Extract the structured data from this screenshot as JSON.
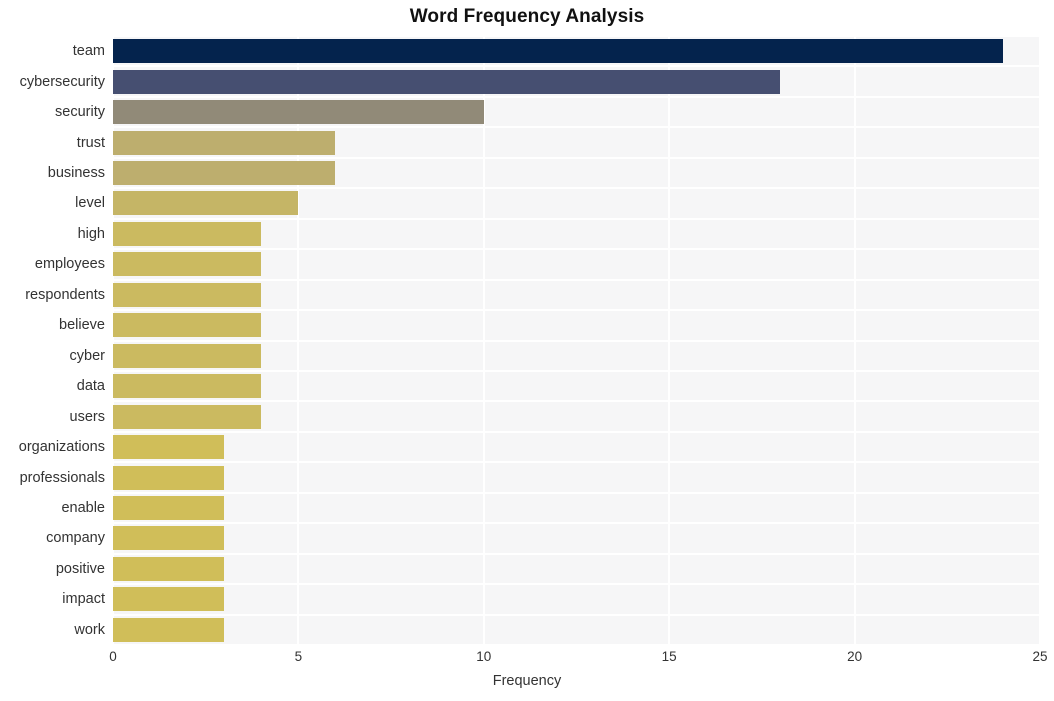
{
  "chart_data": {
    "type": "bar",
    "orientation": "horizontal",
    "title": "Word Frequency Analysis",
    "xlabel": "Frequency",
    "ylabel": "",
    "xlim": [
      0,
      25
    ],
    "xticks": [
      0,
      5,
      10,
      15,
      20,
      25
    ],
    "grid": true,
    "legend": null,
    "categories": [
      "team",
      "cybersecurity",
      "security",
      "trust",
      "business",
      "level",
      "high",
      "employees",
      "respondents",
      "believe",
      "cyber",
      "data",
      "users",
      "organizations",
      "professionals",
      "enable",
      "company",
      "positive",
      "impact",
      "work"
    ],
    "values": [
      24,
      18,
      10,
      6,
      6,
      5,
      4,
      4,
      4,
      4,
      4,
      4,
      4,
      3,
      3,
      3,
      3,
      3,
      3,
      3
    ],
    "bar_colors": [
      "#04234d",
      "#464f71",
      "#918a78",
      "#bdae6e",
      "#bdae6e",
      "#c5b566",
      "#cbba60",
      "#cbba60",
      "#cbba60",
      "#cbba60",
      "#cbba60",
      "#cbba60",
      "#cbba60",
      "#d0be59",
      "#d0be59",
      "#d0be59",
      "#d0be59",
      "#d0be59",
      "#d0be59",
      "#d0be59"
    ]
  },
  "style": {
    "plot_background": "#f6f6f7",
    "page_background": "#ffffff",
    "gridline_color": "#ffffff",
    "text_color": "#333333",
    "title_color": "#111111"
  }
}
